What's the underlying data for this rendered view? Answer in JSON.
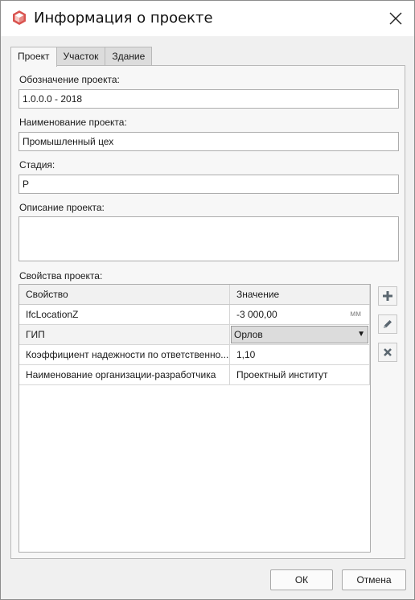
{
  "window": {
    "title": "Информация о проекте"
  },
  "tabs": [
    {
      "label": "Проект"
    },
    {
      "label": "Участок"
    },
    {
      "label": "Здание"
    }
  ],
  "form": {
    "designation_label": "Обозначение проекта:",
    "designation_value": "1.0.0.0 - 2018",
    "name_label": "Наименование проекта:",
    "name_value": "Промышленный цех",
    "stage_label": "Стадия:",
    "stage_value": "P",
    "description_label": "Описание проекта:",
    "description_value": "",
    "properties_label": "Свойства проекта:"
  },
  "properties": {
    "headers": {
      "property": "Свойство",
      "value": "Значение"
    },
    "rows": [
      {
        "property": "IfcLocationZ",
        "value": "-3 000,00",
        "unit": "мм"
      },
      {
        "property": "ГИП",
        "value": "Орлов"
      },
      {
        "property": "Коэффициент надежности по ответственно...",
        "value": "1,10"
      },
      {
        "property": "Наименование организации-разработчика",
        "value": "Проектный институт"
      }
    ]
  },
  "icons": {
    "app": "app-cube-icon",
    "close": "close-icon",
    "add": "plus-icon",
    "edit": "pencil-icon",
    "delete": "delete-x-icon"
  },
  "colors": {
    "icon_red": "#d9534f",
    "icon_gray": "#5b6770"
  },
  "buttons": {
    "ok": "ОК",
    "cancel": "Отмена"
  }
}
